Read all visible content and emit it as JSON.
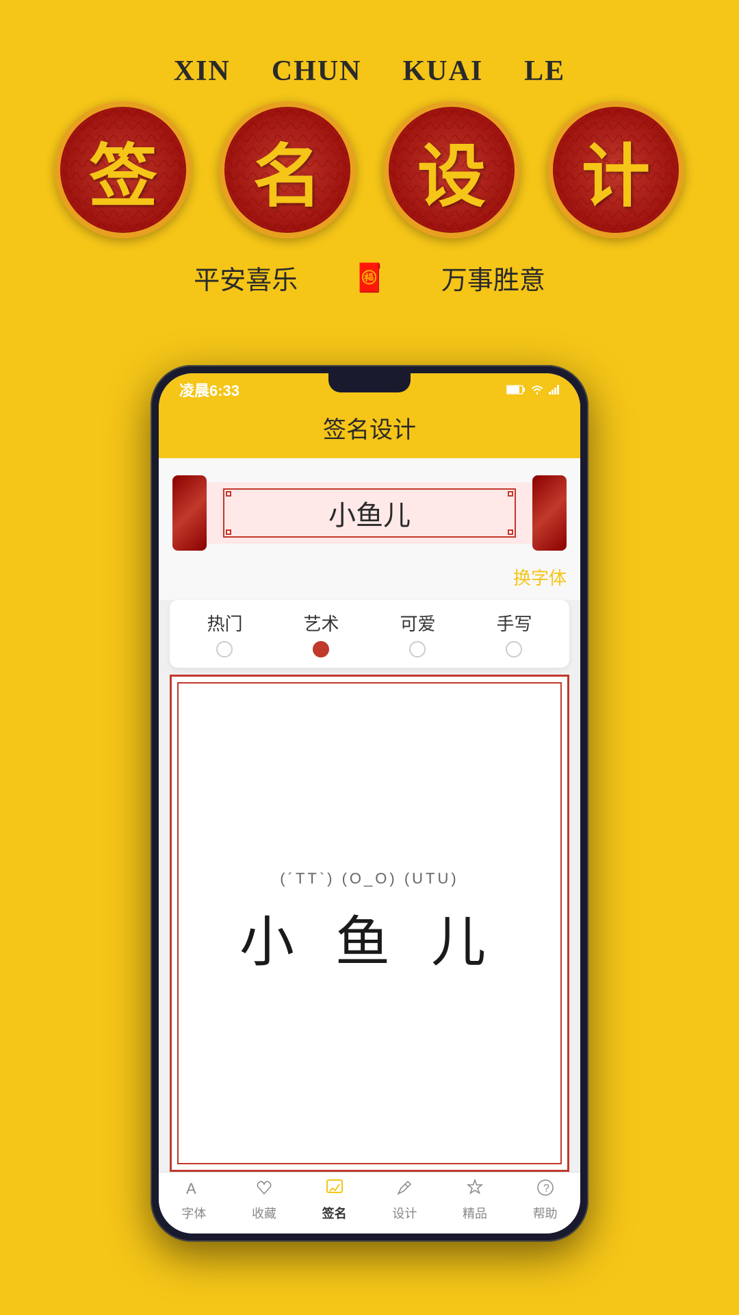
{
  "header": {
    "bg_color": "#F5C518"
  },
  "top_section": {
    "pinyin": [
      "XIN",
      "CHUN",
      "KUAI",
      "LE"
    ],
    "chars": [
      "签",
      "名",
      "设",
      "计"
    ],
    "subtitles": {
      "left": "平安喜乐",
      "right": "万事胜意"
    }
  },
  "phone": {
    "status_bar": {
      "time": "凌晨6:33",
      "icons": "🔋 📶 📶"
    },
    "app_title": "签名设计",
    "scroll_text": "小鱼儿",
    "change_font_btn": "换字体",
    "categories": [
      {
        "label": "热门",
        "active": false
      },
      {
        "label": "艺术",
        "active": true
      },
      {
        "label": "可爱",
        "active": false
      },
      {
        "label": "手写",
        "active": false
      }
    ],
    "signature": {
      "emoticons": "(´TT`) (O_O) (UTU)",
      "text": "小  鱼  儿"
    },
    "bottom_nav": [
      {
        "label": "字体",
        "icon": "A",
        "active": false
      },
      {
        "label": "收藏",
        "icon": "♡",
        "active": false
      },
      {
        "label": "签名",
        "icon": "✏",
        "active": true
      },
      {
        "label": "设计",
        "icon": "✂",
        "active": false
      },
      {
        "label": "精品",
        "icon": "♛",
        "active": false
      },
      {
        "label": "帮助",
        "icon": "?",
        "active": false
      }
    ]
  }
}
